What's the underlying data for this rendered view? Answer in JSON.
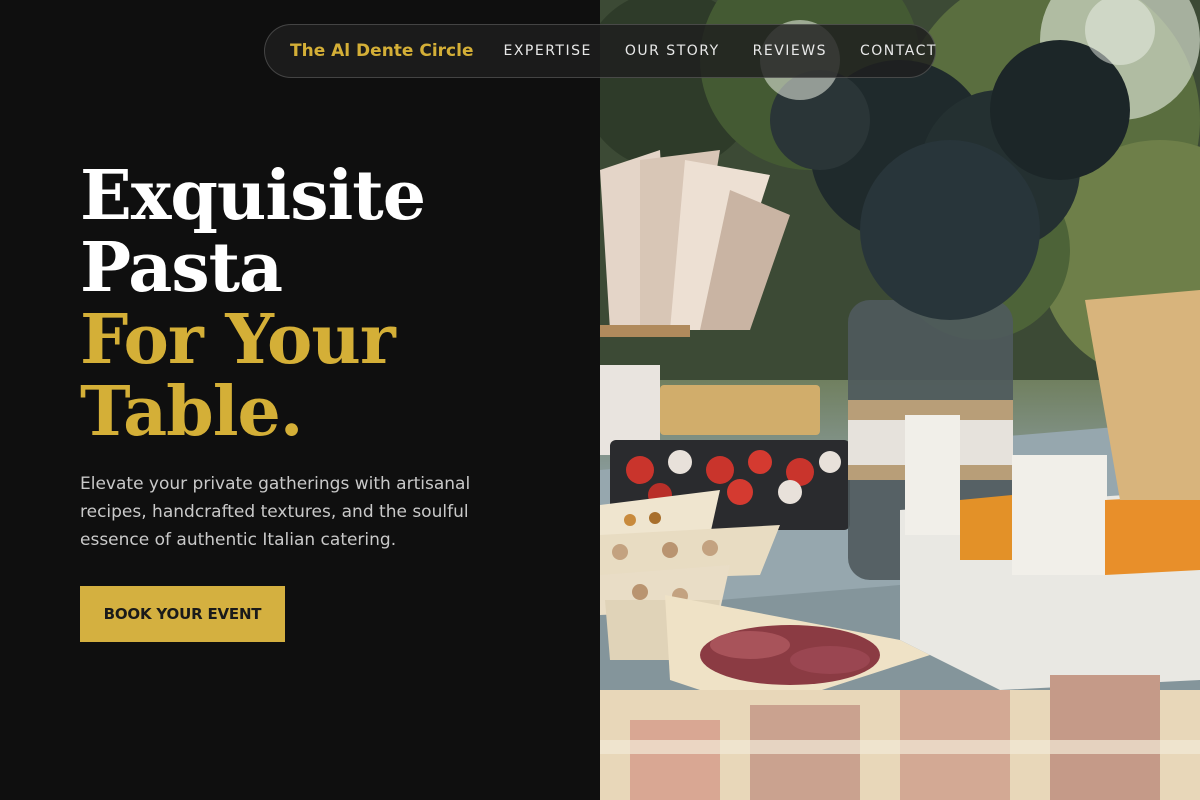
{
  "nav": {
    "brand": "The Al Dente Circle",
    "links": [
      "EXPERTISE",
      "OUR STORY",
      "REVIEWS",
      "CONTACT"
    ]
  },
  "hero": {
    "headline": {
      "line1": "Exquisite",
      "line2": "Pasta",
      "line3": "For Your",
      "line4": "Table."
    },
    "subtitle": "Elevate your private gatherings with artisanal recipes, handcrafted textures, and the soulful essence of authentic Italian catering.",
    "cta_label": "BOOK YOUR EVENT"
  },
  "colors": {
    "accent": "#d4af37",
    "background": "#0f0f0f",
    "text": "#ffffff"
  },
  "image": {
    "subject": "outdoor catering table with appetizers, flower jar and paper cones"
  }
}
